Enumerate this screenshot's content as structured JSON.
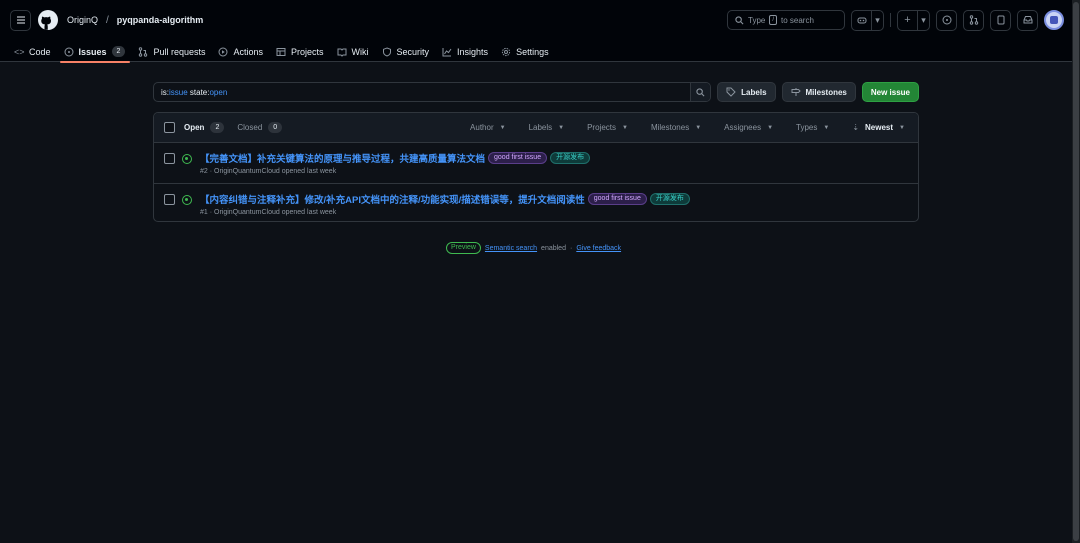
{
  "header": {
    "owner": "OriginQ",
    "separator": "/",
    "repo": "pyqpanda-algorithm",
    "search_prefix": "Type",
    "search_key": "/",
    "search_suffix": "to search",
    "plus_label": "+"
  },
  "tabs": [
    {
      "label": "Code",
      "icon": "code-icon"
    },
    {
      "label": "Issues",
      "icon": "issue-opened-icon",
      "count": "2",
      "active": true
    },
    {
      "label": "Pull requests",
      "icon": "git-pull-request-icon"
    },
    {
      "label": "Actions",
      "icon": "play-icon"
    },
    {
      "label": "Projects",
      "icon": "table-icon"
    },
    {
      "label": "Wiki",
      "icon": "book-icon"
    },
    {
      "label": "Security",
      "icon": "shield-icon"
    },
    {
      "label": "Insights",
      "icon": "graph-icon"
    },
    {
      "label": "Settings",
      "icon": "gear-icon"
    }
  ],
  "toolbar": {
    "filter_is": "is:",
    "filter_is_val": "issue",
    "filter_state": " state:",
    "filter_state_val": "open",
    "labels_label": "Labels",
    "milestones_label": "Milestones",
    "new_issue_label": "New issue"
  },
  "list": {
    "open_label": "Open",
    "open_count": "2",
    "closed_label": "Closed",
    "closed_count": "0",
    "filters": [
      "Author",
      "Labels",
      "Projects",
      "Milestones",
      "Assignees",
      "Types"
    ],
    "sort_label": "Newest"
  },
  "issues": [
    {
      "title": "【完善文档】补充关键算法的原理与推导过程，共建高质量算法文档",
      "labels": [
        {
          "text": "good first issue",
          "color": "#d2a8ff"
        },
        {
          "text": "开源发布",
          "color": "#39d0c8"
        }
      ],
      "meta": "#2 · OriginQuantumCloud opened last week"
    },
    {
      "title": "【内容纠错与注释补充】修改/补充API文档中的注释/功能实现/描述错误等，提升文档阅读性",
      "labels": [
        {
          "text": "good first issue",
          "color": "#d2a8ff"
        },
        {
          "text": "开源发布",
          "color": "#39d0c8"
        }
      ],
      "meta": "#1 · OriginQuantumCloud opened last week"
    }
  ],
  "footer": {
    "preview": "Preview",
    "semantic_search": "Semantic search",
    "enabled": "enabled",
    "dot": "·",
    "feedback": "Give feedback"
  },
  "colors": {
    "background": "#0d1117",
    "link": "#4493f8",
    "open_green": "#3fb950",
    "primary_button": "#238636",
    "active_tab_underline": "#f78166"
  }
}
